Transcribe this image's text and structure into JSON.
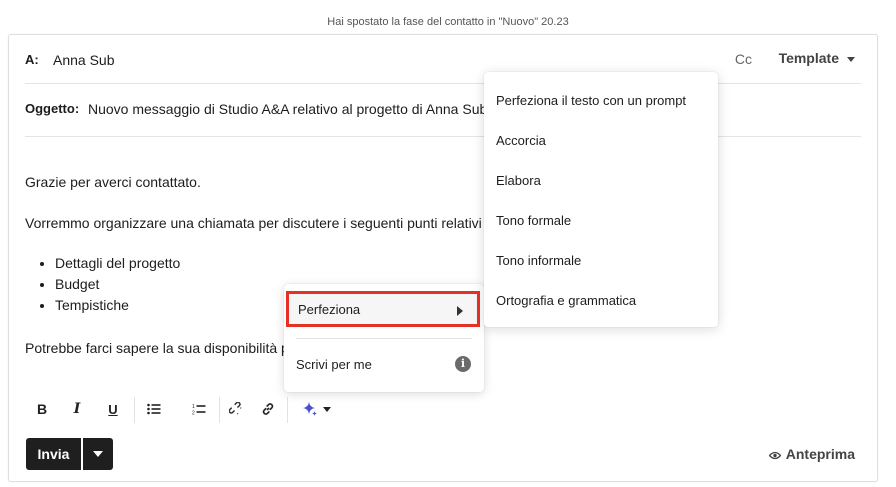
{
  "status_message": "Hai spostato la fase del contatto in \"Nuovo\" 20.23",
  "header": {
    "to_label": "A:",
    "to_value": "Anna Sub",
    "cc_label": "Cc",
    "template_label": "Template"
  },
  "subject": {
    "label": "Oggetto:",
    "value": "Nuovo messaggio di Studio A&A relativo al progetto di Anna Sub"
  },
  "body": {
    "greeting": "Grazie per averci contattato.",
    "intro": "Vorremmo organizzare una chiamata per discutere i seguenti punti relativi",
    "bullets": [
      "Dettagli del progetto",
      "Budget",
      "Tempistiche"
    ],
    "closing": "Potrebbe farci sapere la sua disponibilità p"
  },
  "toolbar": {
    "bold": "B",
    "italic": "I",
    "underline": "U",
    "icons": [
      "bold-icon",
      "italic-icon",
      "underline-icon",
      "bullet-list-icon",
      "numbered-list-icon",
      "unlink-icon",
      "link-icon",
      "ai-sparkle-icon",
      "chevron-down-icon"
    ]
  },
  "footer": {
    "send_label": "Invia",
    "preview_label": "Anteprima"
  },
  "ai_menu": {
    "refine_label": "Perfeziona",
    "write_label": "Scrivi per me",
    "info_glyph": "i"
  },
  "refine_submenu": {
    "items": [
      "Perfeziona il testo con un prompt",
      "Accorcia",
      "Elabora",
      "Tono formale",
      "Tono informale",
      "Ortografia e grammatica"
    ]
  },
  "colors": {
    "highlight_border": "#e63224",
    "send_button": "#1f1f1f",
    "sparkle": "#4a4fd0"
  }
}
